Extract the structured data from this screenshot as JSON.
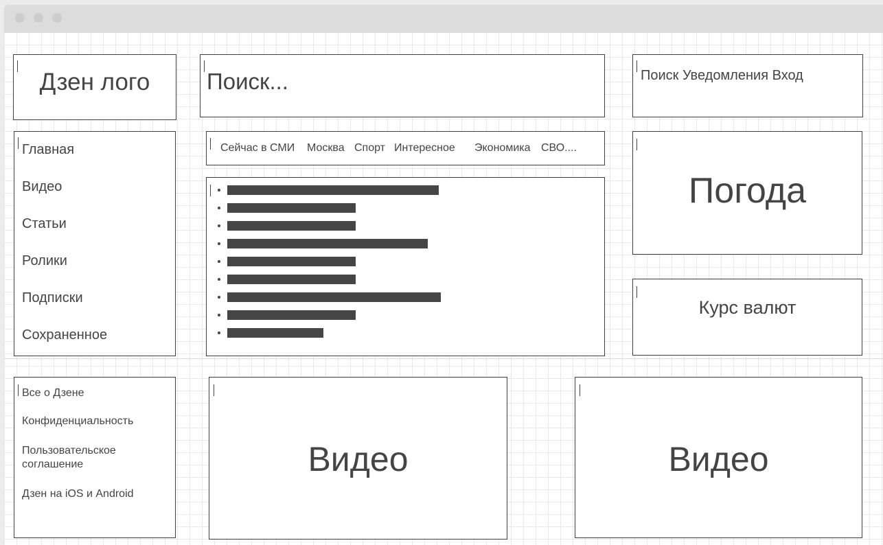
{
  "header": {
    "logo_text": "Дзен лого",
    "search_placeholder": "Поиск...",
    "actions_text": "Поиск Уведомления Вход"
  },
  "sidebar": {
    "items": [
      {
        "label": "Главная"
      },
      {
        "label": "Видео"
      },
      {
        "label": "Статьи"
      },
      {
        "label": "Ролики"
      },
      {
        "label": "Подписки"
      },
      {
        "label": "Сохраненное"
      }
    ]
  },
  "tabs": [
    {
      "label": "Сейчас в СМИ"
    },
    {
      "label": "Москва"
    },
    {
      "label": "Спорт"
    },
    {
      "label": "Интересное"
    },
    {
      "label": "Экономика"
    },
    {
      "label": "СВО...."
    }
  ],
  "news_list": {
    "item_fill_fractions": [
      0.56,
      0.34,
      0.34,
      0.53,
      0.34,
      0.34,
      0.565,
      0.34,
      0.255
    ]
  },
  "widgets": {
    "weather": "Погода",
    "currency": "Курс валют"
  },
  "footer": {
    "links": [
      {
        "label": "Все о Дзене"
      },
      {
        "label": "Конфиденциальность"
      },
      {
        "label": "Пользовательское соглашение"
      },
      {
        "label": "Дзен на iOS и Android"
      }
    ]
  },
  "videos": [
    {
      "label": "Видео"
    },
    {
      "label": "Видео"
    }
  ],
  "colors": {
    "border": "#3e3e3e",
    "text": "#444444",
    "bar": "#464646"
  }
}
